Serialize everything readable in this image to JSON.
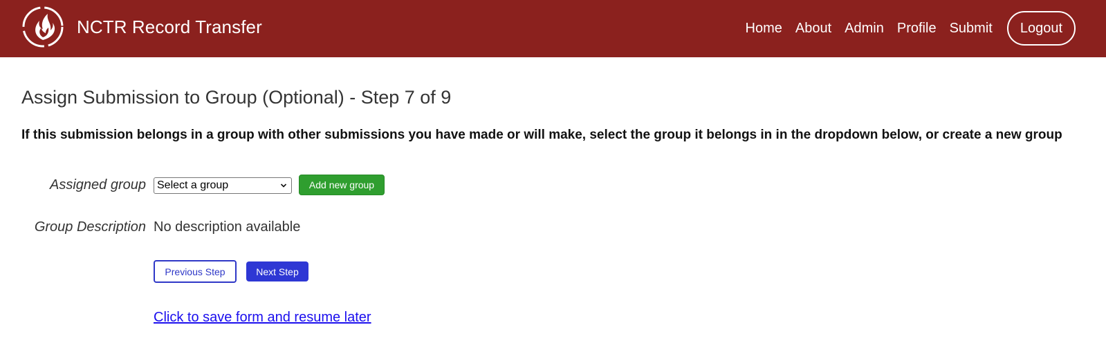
{
  "header": {
    "site_title": "NCTR Record Transfer",
    "logo_icon": "flame-logo-icon",
    "background_color": "#8b211e",
    "nav": [
      {
        "label": "Home"
      },
      {
        "label": "About"
      },
      {
        "label": "Admin"
      },
      {
        "label": "Profile"
      },
      {
        "label": "Submit"
      }
    ],
    "logout_label": "Logout"
  },
  "main": {
    "page_title": "Assign Submission to Group (Optional) - Step 7 of 9",
    "instructions": "If this submission belongs in a group with other submissions you have made or will make, select the group it belongs in in the dropdown below, or create a new group",
    "assigned_group_label": "Assigned group",
    "group_select": {
      "selected": "Select a group"
    },
    "add_group_label": "Add new group",
    "group_description_label": "Group Description",
    "group_description_value": "No description available",
    "previous_label": "Previous Step",
    "next_label": "Next Step",
    "save_link_label": "Click to save form and resume later"
  },
  "colors": {
    "header": "#8b211e",
    "add_button": "#2f9e2f",
    "primary_button": "#2e37d4",
    "link": "#1a0dee"
  }
}
